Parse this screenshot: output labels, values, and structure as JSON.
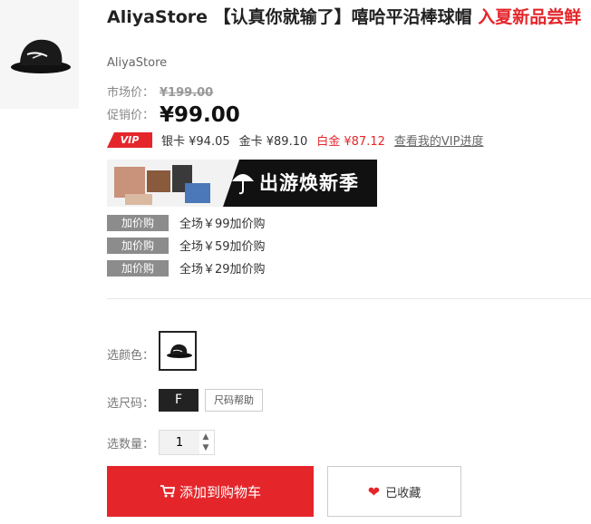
{
  "product": {
    "title_main": "AliyaStore 【认真你就输了】嘻哈平沿棒球帽 ",
    "title_highlight": "入夏新品尝鲜",
    "store": "AliyaStore"
  },
  "pricing": {
    "market_label": "市场价：",
    "market_value": "¥199.00",
    "promo_label": "促销价：",
    "promo_value": "¥99.00",
    "vip_badge": "VIP",
    "silver": "银卡 ¥94.05",
    "gold": "金卡 ¥89.10",
    "platinum": "白金 ¥87.12",
    "vip_link": "查看我的VIP进度"
  },
  "banner": {
    "text": "出游焕新季"
  },
  "addons": [
    {
      "tag": "加价购",
      "text": "全场￥99加价购"
    },
    {
      "tag": "加价购",
      "text": "全场￥59加价购"
    },
    {
      "tag": "加价购",
      "text": "全场￥29加价购"
    }
  ],
  "options": {
    "color_label": "选颜色：",
    "size_label": "选尺码：",
    "size_value": "F",
    "size_help": "尺码帮助",
    "qty_label": "选数量：",
    "qty_value": "1"
  },
  "actions": {
    "add_to_cart": "添加到购物车",
    "favorite": "已收藏"
  },
  "colors": {
    "accent": "#e4262b",
    "dark": "#222222",
    "tag_gray": "#8c8c8c"
  },
  "icons": {
    "cart": "cart-icon",
    "heart": "heart-icon"
  }
}
